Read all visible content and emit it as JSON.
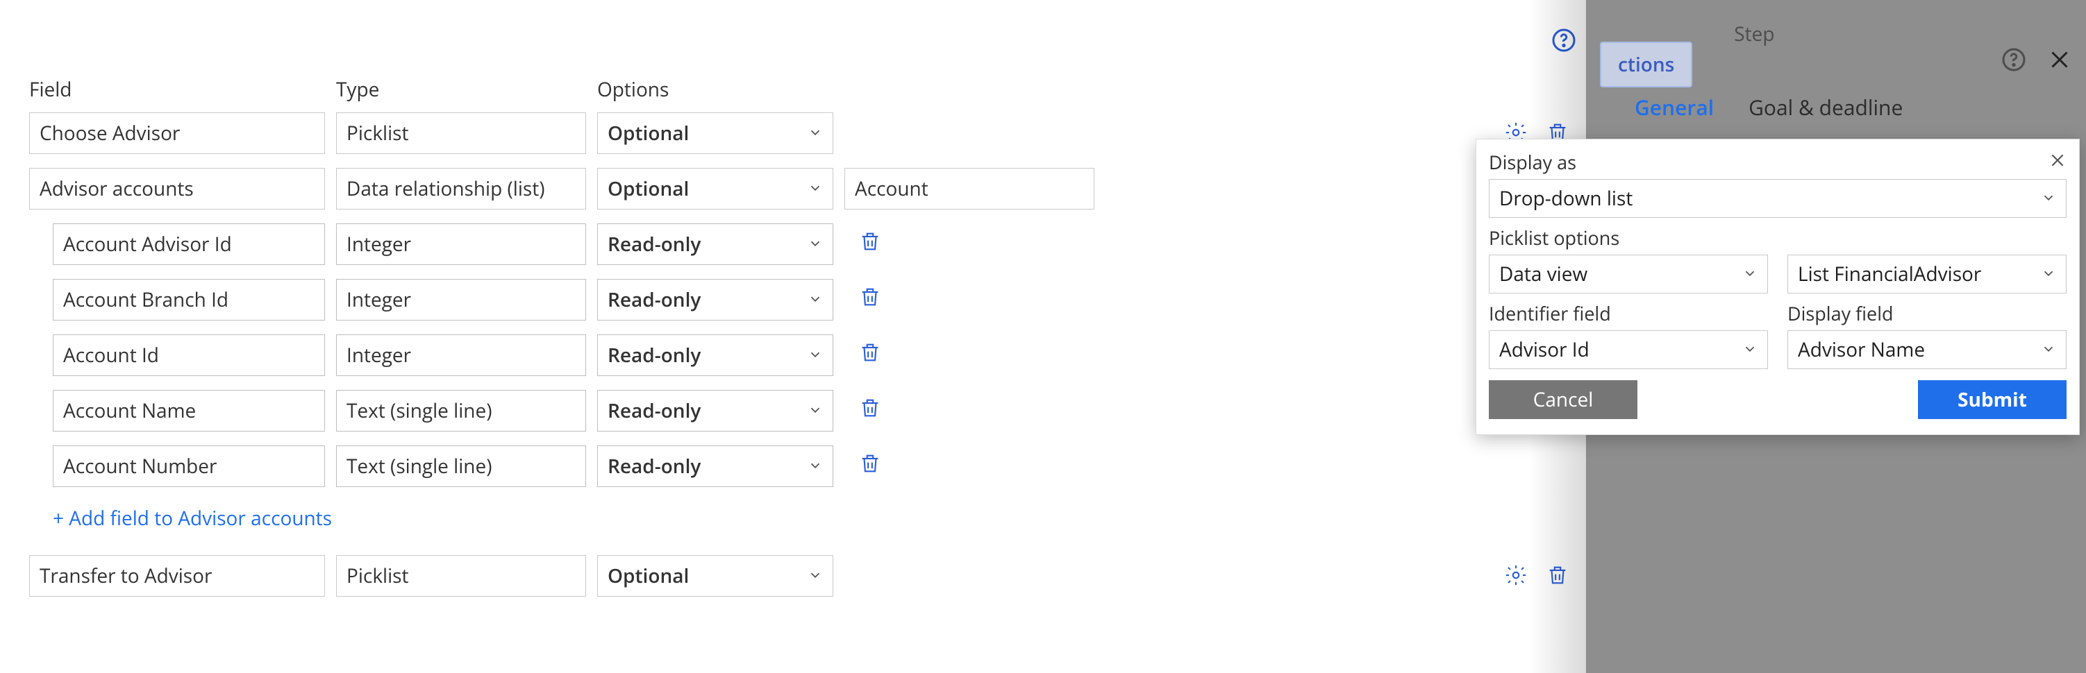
{
  "labels": {
    "field": "Field",
    "type": "Type",
    "options": "Options"
  },
  "rows": {
    "chooseAdvisor": {
      "field": "Choose Advisor",
      "type": "Picklist",
      "option": "Optional"
    },
    "advisorAccounts": {
      "field": "Advisor accounts",
      "type": "Data relationship (list)",
      "option": "Optional",
      "extra": "Account"
    },
    "children": [
      {
        "field": "Account Advisor Id",
        "type": "Integer",
        "option": "Read-only"
      },
      {
        "field": "Account Branch Id",
        "type": "Integer",
        "option": "Read-only"
      },
      {
        "field": "Account Id",
        "type": "Integer",
        "option": "Read-only"
      },
      {
        "field": "Account Name",
        "type": "Text (single line)",
        "option": "Read-only"
      },
      {
        "field": "Account Number",
        "type": "Text (single line)",
        "option": "Read-only"
      }
    ],
    "addLink": "+ Add field to Advisor accounts",
    "transfer": {
      "field": "Transfer to Advisor",
      "type": "Picklist",
      "option": "Optional"
    }
  },
  "sidebar": {
    "actions": "ctions",
    "step": "Step",
    "tabGeneral": "General",
    "tabGoal": "Goal & deadline"
  },
  "modal": {
    "displayAsLabel": "Display as",
    "displayAsValue": "Drop-down list",
    "picklistOptionsLabel": "Picklist options",
    "picklistOptionsValue": "Data view",
    "sourceValue": "List FinancialAdvisor",
    "identifierLabel": "Identifier field",
    "identifierValue": "Advisor Id",
    "displayFieldLabel": "Display field",
    "displayFieldValue": "Advisor Name",
    "cancel": "Cancel",
    "submit": "Submit"
  }
}
